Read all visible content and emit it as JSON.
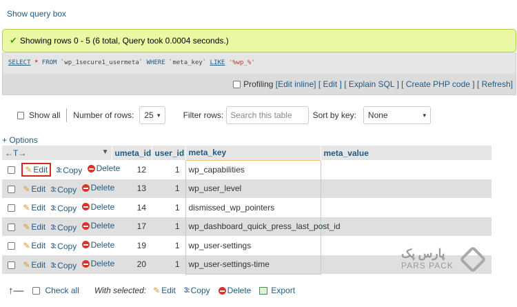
{
  "header": {
    "show_query_box": "Show query box"
  },
  "result": {
    "message": "Showing rows 0 - 5 (6 total, Query took 0.0004 seconds.)"
  },
  "sql": {
    "select": "SELECT",
    "star": "*",
    "from": "FROM",
    "table": "`wp_1secure1_usermeta`",
    "where": "WHERE",
    "column": "`meta_key`",
    "like": "LIKE",
    "pattern": "'%wp_%'"
  },
  "sql_links": {
    "profiling": "Profiling",
    "edit_inline": "[Edit inline]",
    "edit": "[ Edit ]",
    "explain_sql": "[ Explain SQL ]",
    "create_php": "[ Create PHP code ]",
    "refresh": "[ Refresh]"
  },
  "nav": {
    "show_all": "Show all",
    "number_of_rows_label": "Number of rows:",
    "number_of_rows_value": "25",
    "filter_rows_label": "Filter rows:",
    "filter_placeholder": "Search this table",
    "sort_by_key_label": "Sort by key:",
    "sort_by_key_value": "None"
  },
  "options_link": "+ Options",
  "table": {
    "headers": [
      "umeta_id",
      "user_id",
      "meta_key",
      "meta_value"
    ],
    "action_labels": {
      "edit": "Edit",
      "copy": "Copy",
      "delete": "Delete"
    },
    "rows": [
      {
        "umeta_id": "12",
        "user_id": "1",
        "meta_key": "wp_capabilities"
      },
      {
        "umeta_id": "13",
        "user_id": "1",
        "meta_key": "wp_user_level"
      },
      {
        "umeta_id": "14",
        "user_id": "1",
        "meta_key": "dismissed_wp_pointers"
      },
      {
        "umeta_id": "17",
        "user_id": "1",
        "meta_key": "wp_dashboard_quick_press_last_post_id"
      },
      {
        "umeta_id": "19",
        "user_id": "1",
        "meta_key": "wp_user-settings"
      },
      {
        "umeta_id": "20",
        "user_id": "1",
        "meta_key": "wp_user-settings-time"
      }
    ]
  },
  "bottom": {
    "check_all": "Check all",
    "with_selected": "With selected:",
    "edit": "Edit",
    "copy": "Copy",
    "delete": "Delete",
    "export": "Export"
  },
  "brand": {
    "name_fa": "پارس پک",
    "name_en": "PARS PACK"
  },
  "colors": {
    "link": "#235a81",
    "success_bg": "#ebf8a4",
    "success_border": "#a2d246",
    "highlight_border": "#d9241c",
    "row_alt": "#dfdfdf"
  }
}
